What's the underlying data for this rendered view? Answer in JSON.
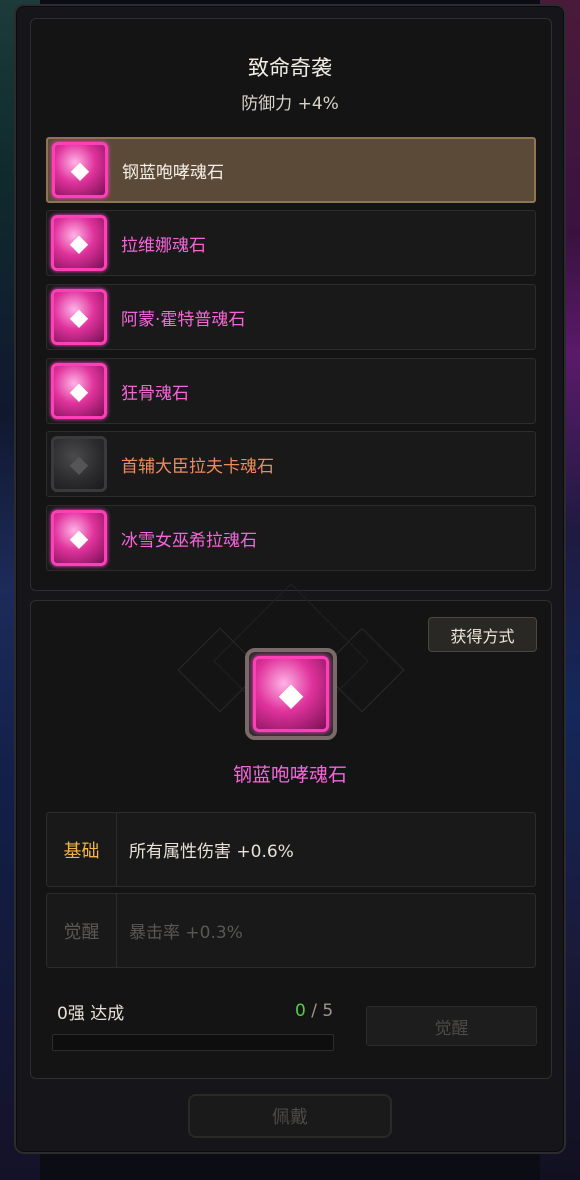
{
  "set": {
    "title": "致命奇袭",
    "bonus": "防御力 +4%"
  },
  "stones": [
    {
      "name": "钢蓝咆哮魂石",
      "selected": true,
      "owned": true
    },
    {
      "name": "拉维娜魂石",
      "selected": false,
      "owned": true
    },
    {
      "name": "阿蒙·霍特普魂石",
      "selected": false,
      "owned": true
    },
    {
      "name": "狂骨魂石",
      "selected": false,
      "owned": true
    },
    {
      "name": "首辅大臣拉夫卡魂石",
      "selected": false,
      "owned": false
    },
    {
      "name": "冰雪女巫希拉魂石",
      "selected": false,
      "owned": true
    }
  ],
  "detail": {
    "acquire_label": "获得方式",
    "name": "钢蓝咆哮魂石",
    "base_label": "基础",
    "base_value": "所有属性伤害 +0.6%",
    "awaken_label": "觉醒",
    "awaken_value": "暴击率 +0.3%"
  },
  "progress": {
    "text": "0强 达成",
    "current": "0",
    "sep": " / ",
    "total": "5",
    "fraction": 0
  },
  "buttons": {
    "awaken": "觉醒",
    "equip": "佩戴"
  },
  "colors": {
    "accent_pink": "#f466d8",
    "base_label": "#f0b44a",
    "progress_green": "#58c94a",
    "selected_bg": "#5b4a38"
  }
}
